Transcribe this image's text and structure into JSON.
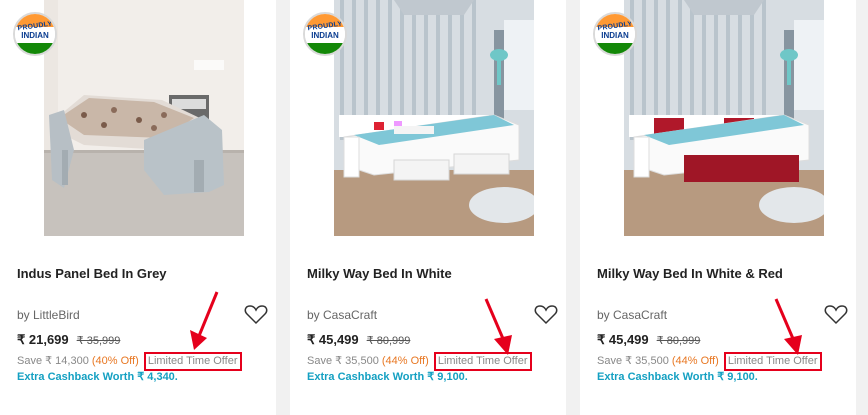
{
  "products": [
    {
      "badge_line1": "PROUDLY",
      "badge_line2": "INDIAN",
      "title": "Indus Panel Bed In Grey",
      "brand": "by LittleBird",
      "price": "₹ 21,699",
      "mrp": "₹ 35,999",
      "save": "Save ₹ 14,300",
      "off": "(40% Off)",
      "offer": "Limited Time Offer",
      "cashback": "Extra Cashback Worth ₹ 4,340."
    },
    {
      "badge_line1": "PROUDLY",
      "badge_line2": "INDIAN",
      "title": "Milky Way Bed In White",
      "brand": "by CasaCraft",
      "price": "₹ 45,499",
      "mrp": "₹ 80,999",
      "save": "Save ₹ 35,500",
      "off": "(44% Off)",
      "offer": "Limited Time Offer",
      "cashback": "Extra Cashback Worth ₹ 9,100."
    },
    {
      "badge_line1": "PROUDLY",
      "badge_line2": "INDIAN",
      "title": "Milky Way Bed In White & Red",
      "brand": "by CasaCraft",
      "price": "₹ 45,499",
      "mrp": "₹ 80,999",
      "save": "Save ₹ 35,500",
      "off": "(44% Off)",
      "offer": "Limited Time Offer",
      "cashback": "Extra Cashback Worth ₹ 9,100."
    }
  ],
  "colors": {
    "offer_highlight": "#e5001c",
    "discount": "#e87722",
    "cashback": "#14a0c2"
  },
  "icons": [
    "heart-icon",
    "annotation-arrow-icon"
  ]
}
